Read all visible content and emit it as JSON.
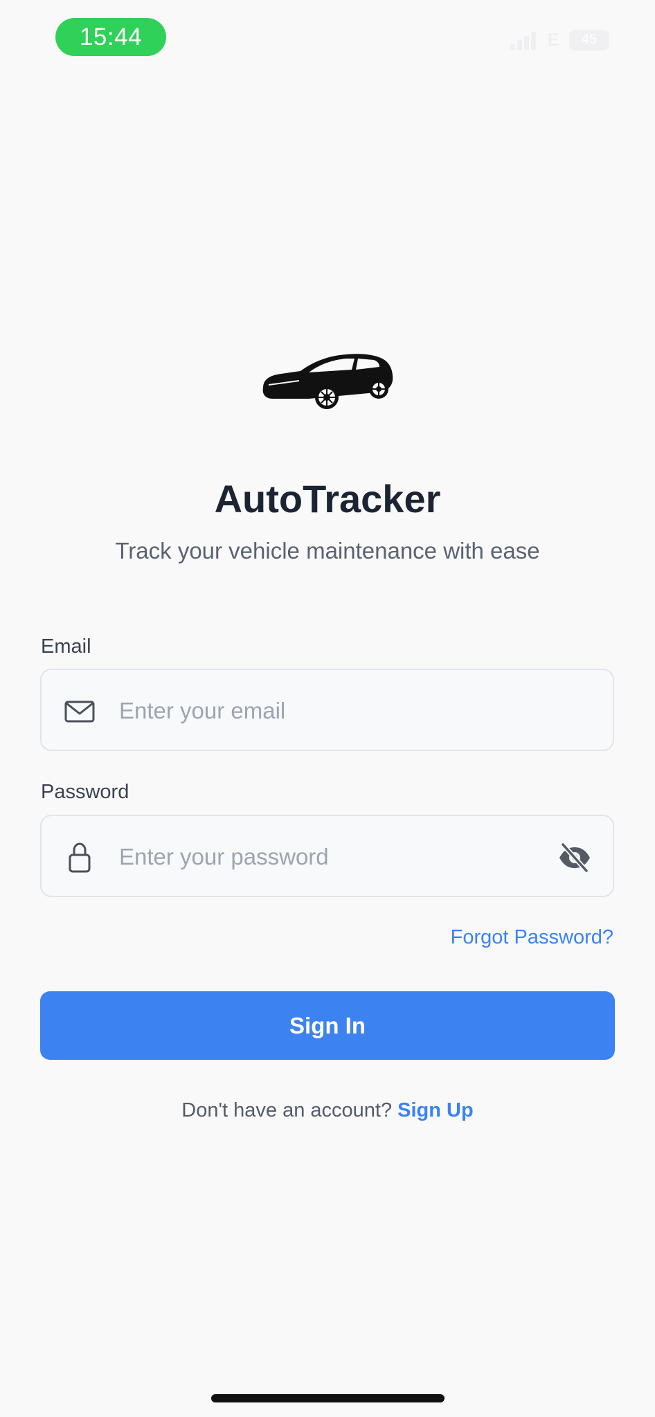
{
  "status_bar": {
    "time": "15:44",
    "network": "E",
    "battery": "45"
  },
  "app": {
    "title": "AutoTracker",
    "subtitle": "Track your vehicle maintenance with ease",
    "logo_icon": "car-icon"
  },
  "form": {
    "email": {
      "label": "Email",
      "placeholder": "Enter your email",
      "value": "",
      "icon": "mail-icon"
    },
    "password": {
      "label": "Password",
      "placeholder": "Enter your password",
      "value": "",
      "icon": "lock-icon",
      "toggle_icon": "eye-off-icon"
    },
    "forgot_password": "Forgot Password?",
    "submit_label": "Sign In"
  },
  "footer": {
    "prompt": "Don't have an account?",
    "signup_label": "Sign Up"
  },
  "colors": {
    "accent": "#3d82f1",
    "status_pill": "#2fd158",
    "title": "#1c2433",
    "background": "#f9f9fa"
  }
}
